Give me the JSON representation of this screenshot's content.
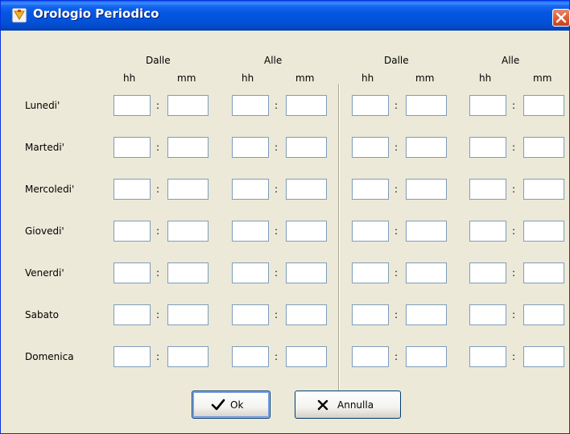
{
  "window": {
    "title": "Orologio Periodico"
  },
  "headers": {
    "groups": [
      "Dalle",
      "Alle",
      "Dalle",
      "Alle"
    ],
    "hh": "hh",
    "mm": "mm"
  },
  "days": [
    "Lunedi'",
    "Martedi'",
    "Mercoledi'",
    "Giovedi'",
    "Venerdi'",
    "Sabato",
    "Domenica"
  ],
  "separator": ":",
  "buttons": {
    "ok": "Ok",
    "cancel": "Annulla"
  },
  "colors": {
    "titlebar": "#0455E2",
    "window_bg": "#ECE9D8",
    "field_border": "#7F9DB9",
    "close": "#E15D38"
  },
  "icons": {
    "app": "clock-app-icon",
    "close": "close-icon",
    "ok": "checkmark-icon",
    "cancel": "x-icon"
  }
}
